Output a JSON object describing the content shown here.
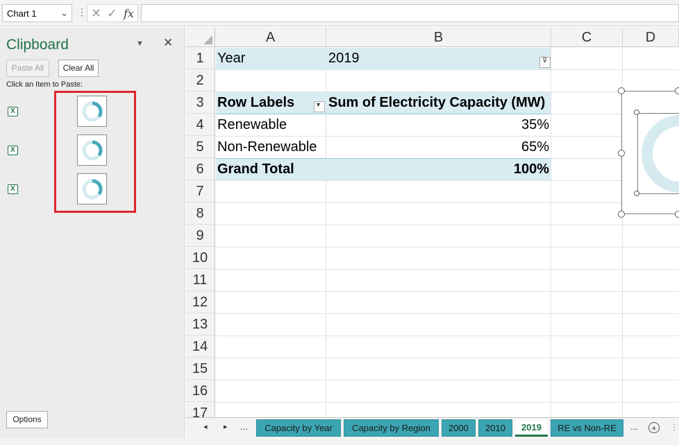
{
  "formula_bar": {
    "name_box": "Chart 1",
    "cancel_icon": "✕",
    "enter_icon": "✓",
    "fx_label": "fx",
    "formula_value": ""
  },
  "clipboard": {
    "title": "Clipboard",
    "paste_all": "Paste All",
    "clear_all": "Clear All",
    "hint": "Click an Item to Paste:",
    "item_icon_label": "X",
    "items": [
      {
        "source": "excel-icon",
        "thumbnail": "donut-chart-thumbnail"
      },
      {
        "source": "excel-icon",
        "thumbnail": "donut-chart-thumbnail"
      },
      {
        "source": "excel-icon",
        "thumbnail": "donut-chart-thumbnail"
      }
    ],
    "options": "Options"
  },
  "sheet": {
    "columns": [
      "A",
      "B",
      "C",
      "D"
    ],
    "rows": [
      "1",
      "2",
      "3",
      "4",
      "5",
      "6",
      "7",
      "8",
      "9",
      "10",
      "11",
      "12",
      "13",
      "14",
      "15",
      "16",
      "17"
    ],
    "year_label": "Year",
    "year_value": "2019",
    "row_labels_header": "Row Labels",
    "sum_header": "Sum of Electricity Capacity (MW)",
    "data_rows": [
      {
        "label": "Renewable",
        "value": "35%"
      },
      {
        "label": "Non-Renewable",
        "value": "65%"
      }
    ],
    "grand_total_label": "Grand Total",
    "grand_total_value": "100%"
  },
  "tabs": {
    "ellipsis_left": "...",
    "items": [
      "Capacity by Year",
      "Capacity by Region",
      "2000",
      "2010",
      "2019",
      "RE vs Non-RE"
    ],
    "active": "2019",
    "ellipsis_right": "..."
  },
  "colors": {
    "excel_green": "#217346",
    "pivot_band": "#d9ecf2",
    "tab_teal": "#3ca5b3",
    "highlight_red": "#e0242d",
    "donut_accent": "#4aa9bb"
  }
}
